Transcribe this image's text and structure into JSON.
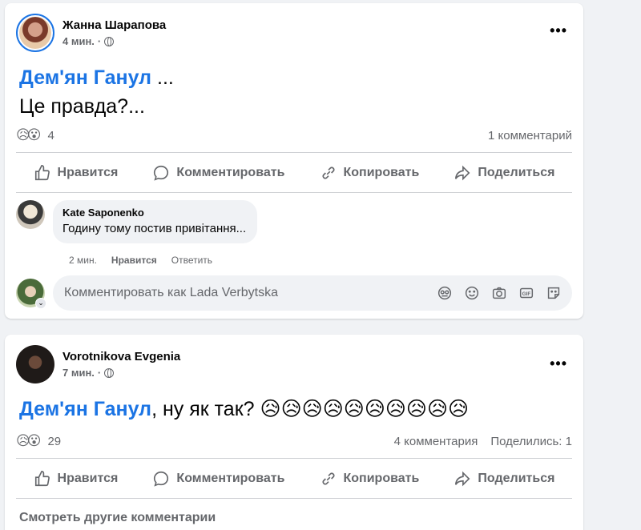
{
  "post1": {
    "author": "Жанна Шарапова",
    "time": "4 мин.",
    "more": "•••",
    "mention": "Дем'ян Ганул",
    "mention_suffix": " ...",
    "line2": "Це правда?...",
    "reaction_emojis": [
      "😥",
      "😮"
    ],
    "reaction_count": "4",
    "comments_count": "1 комментарий",
    "actions": {
      "like": "Нравится",
      "comment": "Комментировать",
      "copy": "Копировать",
      "share": "Поделиться"
    },
    "comment": {
      "author": "Kate Saponenko",
      "text": "Годину тому постив привітання...",
      "time": "2 мин.",
      "like": "Нравится",
      "reply": "Ответить"
    },
    "compose_placeholder": "Комментировать как Lada Verbytska"
  },
  "post2": {
    "author": "Vorotnikova Evgenia",
    "time": "7 мин.",
    "more": "•••",
    "mention": "Дем'ян Ганул",
    "text": ", ну як так? 😥😥😥😥😥😥😥😥😥😥",
    "reaction_emojis": [
      "😥",
      "😮"
    ],
    "reaction_count": "29",
    "comments_count": "4 комментария",
    "shares": "Поделились: 1",
    "actions": {
      "like": "Нравится",
      "comment": "Комментировать",
      "copy": "Копировать",
      "share": "Поделиться"
    },
    "see_more": "Смотреть другие комментарии"
  },
  "colors": {
    "accent": "#1b74e4",
    "secondary_text": "#65676b",
    "background": "#f0f2f5"
  },
  "icons": [
    "globe-icon",
    "more-icon",
    "like-icon",
    "comment-icon",
    "copy-link-icon",
    "share-icon",
    "avatar-sticker-icon",
    "emoji-icon",
    "camera-icon",
    "gif-icon",
    "sticker-icon"
  ]
}
